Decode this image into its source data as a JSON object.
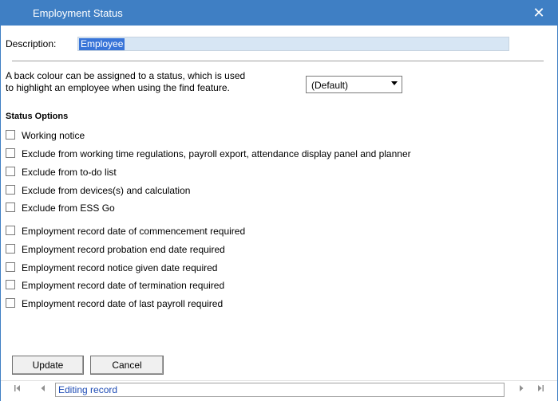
{
  "window": {
    "title": "Employment Status",
    "close_glyph": "✕"
  },
  "description": {
    "label": "Description:",
    "value": "Employee"
  },
  "back_colour": {
    "text_line1": "A back colour can be assigned to a status, which is used",
    "text_line2": "to highlight an employee when using the find feature.",
    "selected": "(Default)",
    "arrow_icon": "chevron-down-icon"
  },
  "status_options": {
    "heading": "Status Options",
    "group1": [
      {
        "label": "Working notice",
        "checked": false
      },
      {
        "label": "Exclude from working time regulations, payroll export, attendance display panel and planner",
        "checked": false
      },
      {
        "label": "Exclude from to-do list",
        "checked": false
      },
      {
        "label": "Exclude from devices(s) and calculation",
        "checked": false
      },
      {
        "label": "Exclude from ESS Go",
        "checked": false
      }
    ],
    "group2": [
      {
        "label": "Employment record date of commencement required",
        "checked": false
      },
      {
        "label": "Employment record probation end date required",
        "checked": false
      },
      {
        "label": "Employment record notice given date required",
        "checked": false
      },
      {
        "label": "Employment record date of termination required",
        "checked": false
      },
      {
        "label": "Employment record date of last payroll required",
        "checked": false
      }
    ]
  },
  "buttons": {
    "update": "Update",
    "cancel": "Cancel"
  },
  "navigator": {
    "first_icon": "first-record-icon",
    "prev_icon": "previous-record-icon",
    "status_text": "Editing record",
    "next_icon": "next-record-icon",
    "last_icon": "last-record-icon"
  },
  "colors": {
    "titlebar": "#3f7fc4",
    "selection": "#3874d8",
    "input_bg": "#d7e6f4",
    "status_text": "#1d4bb5"
  }
}
